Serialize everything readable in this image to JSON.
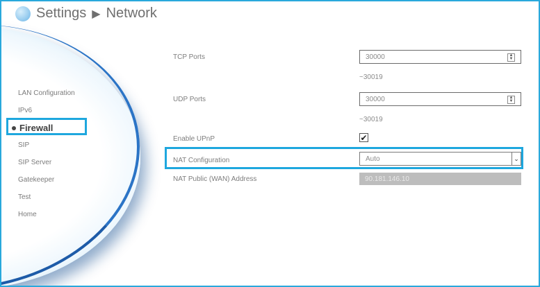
{
  "header": {
    "section": "Settings",
    "page": "Network",
    "separator": "▶"
  },
  "sidebar": {
    "items": [
      {
        "label": "LAN Configuration"
      },
      {
        "label": "IPv6"
      },
      {
        "label": "Firewall",
        "selected": true
      },
      {
        "label": "SIP"
      },
      {
        "label": "SIP Server"
      },
      {
        "label": "Gatekeeper"
      },
      {
        "label": "Test"
      },
      {
        "label": "Home"
      }
    ]
  },
  "form": {
    "tcp_ports": {
      "label": "TCP Ports",
      "value": "30000",
      "range_end": "~30019"
    },
    "udp_ports": {
      "label": "UDP Ports",
      "value": "30000",
      "range_end": "~30019"
    },
    "upnp": {
      "label": "Enable UPnP",
      "checked": true,
      "check_glyph": "✔"
    },
    "nat": {
      "label": "NAT Configuration",
      "value": "Auto",
      "arrow": "⌄"
    },
    "wan_address": {
      "label": "NAT Public (WAN) Address",
      "value": "90.181.146.10"
    }
  },
  "colors": {
    "highlight": "#1ea7de",
    "frame": "#29a8dc"
  },
  "icons": {
    "spinner": "spinner-icon",
    "dropdown": "chevron-down-icon",
    "logo": "settings-logo-icon",
    "checkmark": "checkmark-icon"
  }
}
